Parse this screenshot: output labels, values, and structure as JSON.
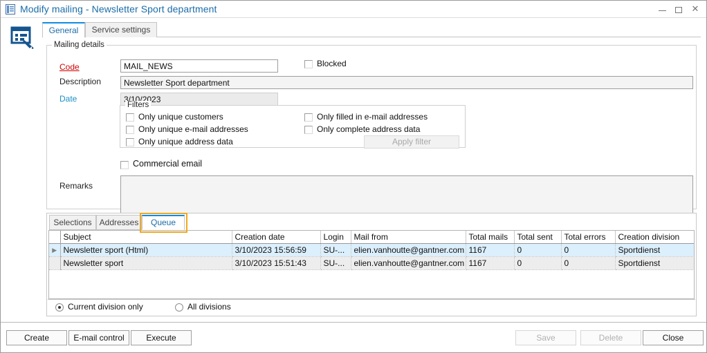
{
  "window": {
    "title": "Modify mailing - Newsletter Sport department",
    "icon": "document-list-icon",
    "minimize_label": "minimize-icon",
    "maximize_label": "maximize-icon",
    "close_label": "✕",
    "app_icon": "mailing-edit-icon"
  },
  "tabs": {
    "general": "General",
    "service_settings": "Service settings"
  },
  "mailing_details": {
    "legend": "Mailing details",
    "code_label": "Code",
    "code_value": "MAIL_NEWS",
    "description_label": "Description",
    "description_value": "Newsletter Sport department",
    "date_label": "Date",
    "date_value": "3/10/2023",
    "blocked_label": "Blocked",
    "blocked_checked": false,
    "remarks_label": "Remarks",
    "remarks_value": "",
    "commercial_email_label": "Commercial email",
    "commercial_email_checked": false,
    "scroll_up_icon": "∧",
    "scroll_down_icon": "∨"
  },
  "filters": {
    "legend": "Filters",
    "items": [
      {
        "label": "Only unique customers",
        "checked": false
      },
      {
        "label": "Only unique e-mail addresses",
        "checked": false
      },
      {
        "label": "Only unique address data",
        "checked": false
      },
      {
        "label": "Only filled in e-mail addresses",
        "checked": false
      },
      {
        "label": "Only complete address data",
        "checked": false
      }
    ],
    "apply_filter_label": "Apply filter",
    "apply_filter_enabled": false
  },
  "lower_tabs": {
    "selections": "Selections",
    "addresses": "Addresses",
    "queue": "Queue",
    "active": "Queue",
    "highlight_color": "#f0a81c"
  },
  "grid": {
    "columns": [
      "Subject",
      "Creation date",
      "Login",
      "Mail from",
      "Total mails",
      "Total sent",
      "Total errors",
      "Creation division"
    ],
    "row_marker": "▶",
    "rows": [
      {
        "subject": "Newsletter sport (Html)",
        "creation_date": "3/10/2023 15:56:59",
        "login": "SU-...",
        "mail_from": "elien.vanhoutte@gantner.com",
        "total_mails": "1167",
        "total_sent": "0",
        "total_errors": "0",
        "creation_division": "Sportdienst",
        "selected": true
      },
      {
        "subject": "Newsletter sport",
        "creation_date": "3/10/2023 15:51:43",
        "login": "SU-...",
        "mail_from": "elien.vanhoutte@gantner.com",
        "total_mails": "1167",
        "total_sent": "0",
        "total_errors": "0",
        "creation_division": "Sportdienst",
        "selected": false
      }
    ]
  },
  "division_scope": {
    "current_label": "Current division only",
    "all_label": "All divisions",
    "selected": "Current division only"
  },
  "footer": {
    "create_label": "Create",
    "email_control_label": "E-mail control",
    "execute_label": "Execute",
    "save_label": "Save",
    "save_enabled": false,
    "delete_label": "Delete",
    "delete_enabled": false,
    "close_label": "Close",
    "close_enabled": true
  },
  "colors": {
    "title_blue": "#1b6ca8",
    "accent_blue": "#0f8ce0",
    "code_red": "#cc0000",
    "date_teal": "#1b8fc4",
    "selected_row": "#dbeffc",
    "alt_row": "#ededed",
    "highlight_orange": "#f0a81c"
  }
}
